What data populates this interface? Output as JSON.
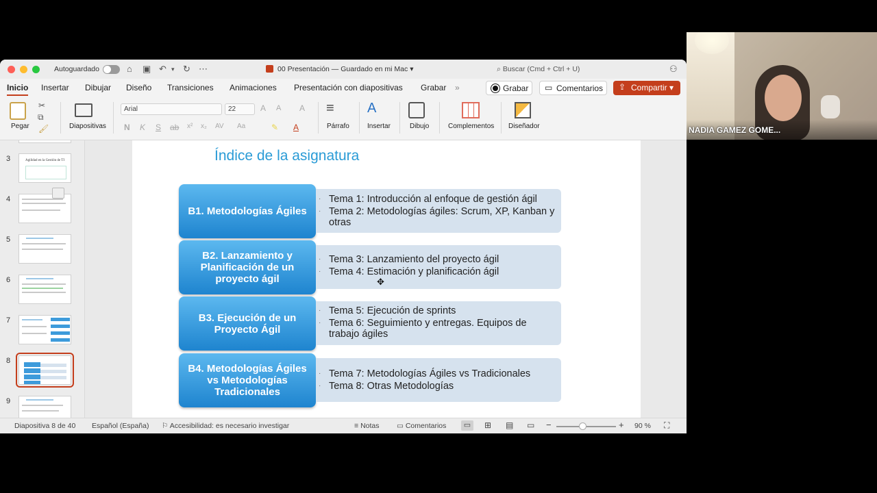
{
  "window": {
    "autosave_label": "Autoguardado",
    "doc_title": "00 Presentación — Guardado en mi Mac",
    "search_placeholder": "Buscar (Cmd + Ctrl + U)"
  },
  "tabs": [
    "Inicio",
    "Insertar",
    "Dibujar",
    "Diseño",
    "Transiciones",
    "Animaciones",
    "Presentación con diapositivas",
    "Grabar"
  ],
  "ribbon_buttons": {
    "record": "Grabar",
    "comments": "Comentarios",
    "share": "Compartir"
  },
  "toolbar": {
    "paste": "Pegar",
    "slides": "Diapositivas",
    "font": "Arial",
    "size": "22",
    "paragraph": "Párrafo",
    "insert": "Insertar",
    "draw": "Dibujo",
    "addins": "Complementos",
    "designer": "Diseñador"
  },
  "thumbnails": {
    "numbers": [
      "3",
      "4",
      "5",
      "6",
      "7",
      "8",
      "9"
    ],
    "selected": "8",
    "thumb3_title": "Agilidad en la Gestión de TI"
  },
  "slide": {
    "title": "Índice de la asignatura",
    "blocks": [
      {
        "label": "B1. Metodologías Ágiles",
        "items": [
          "Tema 1: Introducción al enfoque de gestión ágil",
          "Tema 2: Metodologías ágiles: Scrum, XP, Kanban y otras"
        ]
      },
      {
        "label": "B2. Lanzamiento y Planificación de un proyecto ágil",
        "items": [
          "Tema 3: Lanzamiento del proyecto ágil",
          "Tema 4: Estimación y planificación ágil"
        ]
      },
      {
        "label": "B3. Ejecución de un Proyecto Ágil",
        "items": [
          "Tema 5:  Ejecución de sprints",
          "Tema 6: Seguimiento y entregas. Equipos de trabajo ágiles"
        ]
      },
      {
        "label": "B4. Metodologías Ágiles vs Metodologías Tradicionales",
        "items": [
          "Tema 7: Metodologías Ágiles vs Tradicionales",
          "Tema 8: Otras Metodologías"
        ]
      }
    ]
  },
  "status": {
    "slide_count": "Diapositiva 8 de 40",
    "language": "Español (España)",
    "accessibility": "Accesibilidad: es necesario investigar",
    "notes": "Notas",
    "comments": "Comentarios",
    "zoom": "90 %"
  },
  "webcam": {
    "participant_name": "NADIA GAMEZ GOME..."
  },
  "colors": {
    "accent": "#c43e1c",
    "slide_title": "#2a9bd6",
    "block_blue": "#1e84cf",
    "panel": "#d6e2ee"
  }
}
